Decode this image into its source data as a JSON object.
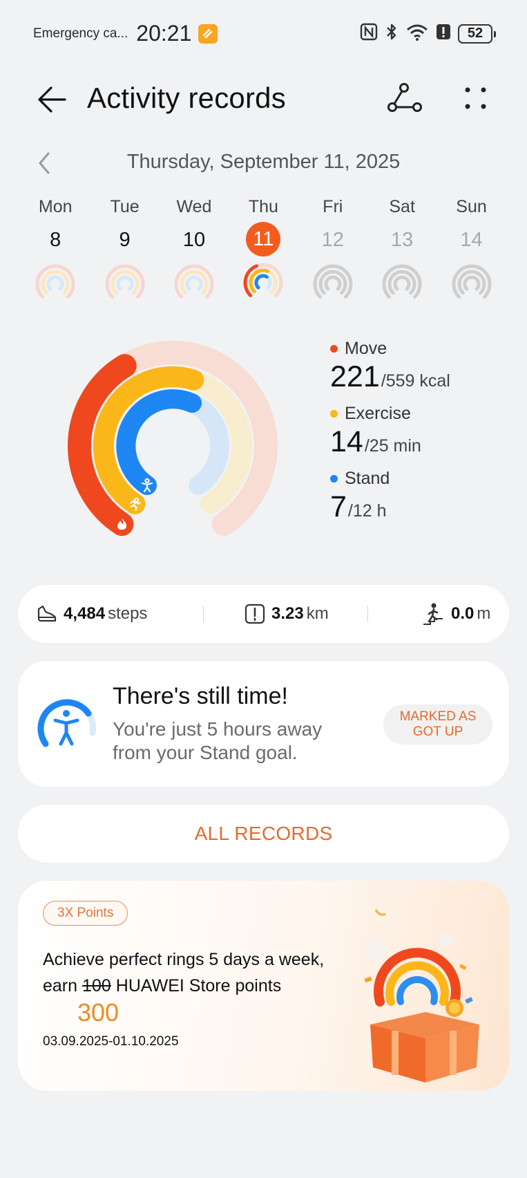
{
  "status_bar": {
    "carrier": "Emergency ca...",
    "time": "20:21",
    "battery": "52",
    "icons": [
      "nfc-icon",
      "bluetooth-icon",
      "wifi-icon",
      "alert-icon",
      "battery-icon"
    ]
  },
  "header": {
    "title": "Activity records",
    "back_icon": "arrow-left-icon",
    "route_icon": "route-icon",
    "more_icon": "more-dots-icon"
  },
  "date_nav": {
    "date": "Thursday, September 11, 2025"
  },
  "week": [
    {
      "name": "Mon",
      "num": "8",
      "state": "past"
    },
    {
      "name": "Tue",
      "num": "9",
      "state": "past"
    },
    {
      "name": "Wed",
      "num": "10",
      "state": "past"
    },
    {
      "name": "Thu",
      "num": "11",
      "state": "today"
    },
    {
      "name": "Fri",
      "num": "12",
      "state": "future"
    },
    {
      "name": "Sat",
      "num": "13",
      "state": "future"
    },
    {
      "name": "Sun",
      "num": "14",
      "state": "future"
    }
  ],
  "rings": {
    "move": {
      "label": "Move",
      "value": "221",
      "goal": "/559 kcal",
      "color": "#f0481e",
      "progress": 0.395
    },
    "exercise": {
      "label": "Exercise",
      "value": "14",
      "goal": "/25 min",
      "color": "#fbb61a",
      "progress": 0.56
    },
    "stand": {
      "label": "Stand",
      "value": "7",
      "goal": "/12 h",
      "color": "#1e86f3",
      "progress": 0.583
    }
  },
  "stats": {
    "steps_value": "4,484",
    "steps_unit": "steps",
    "distance_value": "3.23",
    "distance_unit": "km",
    "climb_value": "0.0",
    "climb_unit": "m"
  },
  "reminder": {
    "title": "There's still time!",
    "body": "You're just 5 hours away from your Stand goal.",
    "button_line1": "MARKED AS",
    "button_line2": "GOT UP"
  },
  "all_records_label": "ALL RECORDS",
  "promo": {
    "badge": "3X Points",
    "line1": "Achieve perfect rings 5 days a week,",
    "line2_prefix": "earn",
    "old_points": "100",
    "line2_suffix": "HUAWEI Store points",
    "new_points": "300",
    "dates": "03.09.2025-01.10.2025"
  }
}
